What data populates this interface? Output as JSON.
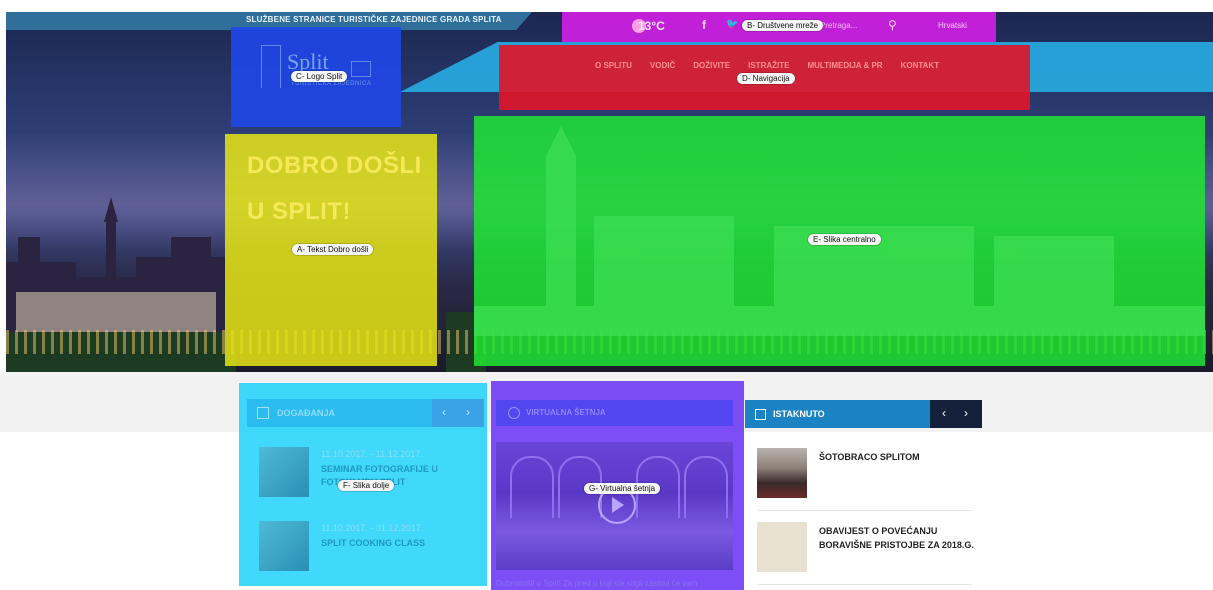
{
  "site": {
    "strip_text": "SLUŽBENE STRANICE TURISTIČKE ZAJEDNICE GRADA SPLITA"
  },
  "social": {
    "temperature": "13°C",
    "facebook_icon": "f",
    "twitter_icon": "🐦",
    "search_placeholder": "Pretraga...",
    "language": "Hrvatski",
    "tag": "B- Društvene mreže"
  },
  "logo": {
    "word": "Split",
    "subtitle": "TURISTIČKA ZAJEDNICA",
    "tag": "C- Logo Split"
  },
  "navigation": {
    "items": [
      "O SPLITU",
      "VODIČ",
      "DOŽIVITE",
      "ISTRAŽITE",
      "MULTIMEDIJA & PR",
      "KONTAKT"
    ],
    "tag": "D- Navigacija"
  },
  "welcome": {
    "line1": "DOBRO DOŠLI",
    "line2": "U SPLIT!",
    "tag": "A- Tekst Dobro došli"
  },
  "central_image": {
    "tag": "E- Slika centralno"
  },
  "events": {
    "title": "DOGAĐANJA",
    "prev": "‹",
    "next": "›",
    "items": [
      {
        "date": "11.10.2017. - 11.12.2017.",
        "title": "SEMINAR FOTOGRAFIJE U FOTOKLUBU SPLIT"
      },
      {
        "date": "11.10.2017. - 31.12.2017.",
        "title": "SPLIT COOKING CLASS"
      }
    ],
    "tag": "F- Slika dolje"
  },
  "virtual_tour": {
    "title": "VIRTUALNA ŠETNJA",
    "caption": "Dobrodošli u Split! Za pred u koji ste stigli zaslovi će vam",
    "tag": "G- Virtualna šetnja"
  },
  "featured": {
    "title": "ISTAKNUTO",
    "prev": "‹",
    "next": "›",
    "items": [
      {
        "title": "ŠOTOBRACO SPLITOM"
      },
      {
        "title": "OBAVIJEST O POVEĆANJU BORAVIŠNE PRISTOJBE ZA 2018.G."
      }
    ]
  },
  "colors": {
    "social_overlay": "#de1ef0",
    "logo_overlay": "#1e46e6",
    "nav_overlay": "#e11428",
    "welcome_overlay": "#e8e614",
    "central_overlay": "#1ee632",
    "events_overlay": "#1ed2fa",
    "virtual_overlay": "#6e3cf5",
    "featured_header": "#1b83c4"
  }
}
